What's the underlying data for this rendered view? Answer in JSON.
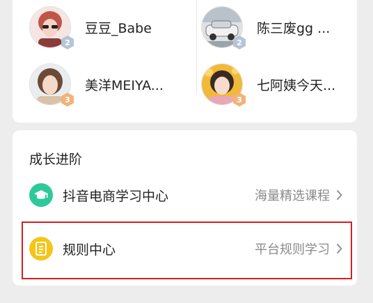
{
  "following_users": [
    {
      "name": "豆豆_Babe",
      "level": "2"
    },
    {
      "name": "陈三废gg ...",
      "level": "2"
    },
    {
      "name": "美洋MEIYA...",
      "level": "3"
    },
    {
      "name": "七阿姨今天...",
      "level": "3"
    }
  ],
  "growth": {
    "title": "成长进阶",
    "items": [
      {
        "label": "抖音电商学习中心",
        "sub": "海量精选课程",
        "icon": "graduation-cap-icon",
        "icon_color": "#2ec99b"
      },
      {
        "label": "规则中心",
        "sub": "平台规则学习",
        "icon": "document-icon",
        "icon_color": "#f5c518"
      }
    ]
  },
  "colors": {
    "background": "#ededee",
    "highlight": "#d81e1e",
    "level2_badge": "#b7c4d6",
    "level3_badge": "#f2b27a"
  }
}
